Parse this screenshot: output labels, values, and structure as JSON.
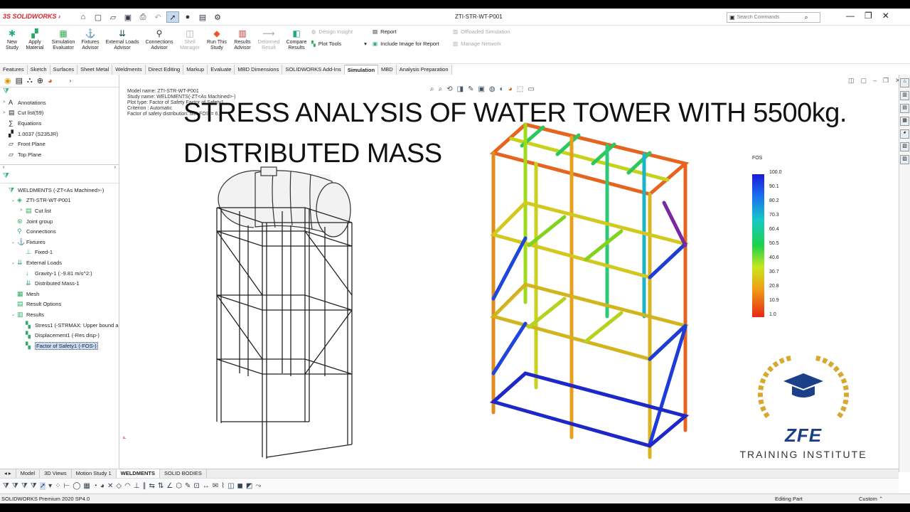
{
  "app": {
    "brand": "SOLIDWORKS",
    "document_title": "ZTI-STR-WT-P001"
  },
  "search": {
    "placeholder": "Search Commands"
  },
  "ribbon": {
    "buttons": [
      {
        "label": "New\nStudy",
        "enabled": true
      },
      {
        "label": "Apply\nMaterial",
        "enabled": true
      },
      {
        "label": "Simulation\nEvaluator",
        "enabled": true
      },
      {
        "label": "Fixtures\nAdvisor",
        "enabled": true
      },
      {
        "label": "External Loads\nAdvisor",
        "enabled": true
      },
      {
        "label": "Connections\nAdvisor",
        "enabled": true
      },
      {
        "label": "Shell\nManager",
        "enabled": false
      },
      {
        "label": "Run This\nStudy",
        "enabled": true
      },
      {
        "label": "Results\nAdvisor",
        "enabled": true
      },
      {
        "label": "Deformed\nResult",
        "enabled": false
      },
      {
        "label": "Compare\nResults",
        "enabled": true
      }
    ],
    "design_insight": "Design Insight",
    "plot_tools": "Plot Tools",
    "report": "Report",
    "include_image": "Include Image for Report",
    "offloaded": "Offloaded Simulation",
    "manage_network": "Manage Network"
  },
  "tabs": [
    "Features",
    "Sketch",
    "Surfaces",
    "Sheet Metal",
    "Weldments",
    "Direct Editing",
    "Markup",
    "Evaluate",
    "MBD Dimensions",
    "SOLIDWORKS Add-Ins",
    "Simulation",
    "MBD",
    "Analysis Preparation"
  ],
  "active_tab": "Simulation",
  "feature_tree": [
    {
      "label": "Annotations",
      "icon": "annotation-icon",
      "arrow": ">"
    },
    {
      "label": "Cut list(59)",
      "icon": "cut-list-icon",
      "arrow": ">"
    },
    {
      "label": "Equations",
      "icon": "equations-icon",
      "arrow": ""
    },
    {
      "label": "1.0037 (S235JR)",
      "icon": "material-icon",
      "arrow": ""
    },
    {
      "label": "Front Plane",
      "icon": "plane-icon",
      "arrow": ""
    },
    {
      "label": "Top Plane",
      "icon": "plane-icon",
      "arrow": ""
    }
  ],
  "sim_tree": [
    {
      "label": "WELDMENTS (-ZT<As Machined>-)",
      "icon": "study-icon",
      "indent": 0,
      "arrow": ""
    },
    {
      "label": "ZTI-STR-WT-P001",
      "icon": "part-icon",
      "indent": 1,
      "arrow": "v"
    },
    {
      "label": "Cut list",
      "icon": "cut-list-icon",
      "indent": 2,
      "arrow": ">"
    },
    {
      "label": "Joint group",
      "icon": "joint-icon",
      "indent": 1,
      "arrow": ""
    },
    {
      "label": "Connections",
      "icon": "connections-icon",
      "indent": 1,
      "arrow": ""
    },
    {
      "label": "Fixtures",
      "icon": "fixtures-icon",
      "indent": 1,
      "arrow": "v"
    },
    {
      "label": "Fixed-1",
      "icon": "fixed-icon",
      "indent": 2,
      "arrow": ""
    },
    {
      "label": "External Loads",
      "icon": "loads-icon",
      "indent": 1,
      "arrow": "v"
    },
    {
      "label": "Gravity-1 (:-9.81 m/s^2:)",
      "icon": "gravity-icon",
      "indent": 2,
      "arrow": ""
    },
    {
      "label": "Distributed Mass-1",
      "icon": "mass-icon",
      "indent": 2,
      "arrow": ""
    },
    {
      "label": "Mesh",
      "icon": "mesh-icon",
      "indent": 1,
      "arrow": ""
    },
    {
      "label": "Result Options",
      "icon": "result-options-icon",
      "indent": 1,
      "arrow": ""
    },
    {
      "label": "Results",
      "icon": "results-icon",
      "indent": 1,
      "arrow": "v"
    },
    {
      "label": "Stress1 (-STRMAX: Upper bound a",
      "icon": "plot-icon",
      "indent": 2,
      "arrow": ""
    },
    {
      "label": "Displacement1 (-Res disp-)",
      "icon": "plot-icon",
      "indent": 2,
      "arrow": ""
    },
    {
      "label": "Factor of Safety1 (-FOS-)",
      "icon": "plot-icon",
      "indent": 2,
      "arrow": "",
      "selected": true
    }
  ],
  "study_info": [
    "Model name: ZTI-STR-WT-P001",
    "Study name: WELDMENTS(-ZT<As Machined>-)",
    "Plot type: Factor of Safety Factor of Safety1",
    "Criterion : Automatic",
    "Factor of safety distribution: Min FOS = 6.8"
  ],
  "overlay": {
    "line1": "STRESS ANALYSIS OF WATER TOWER WITH 5500kg.",
    "line2": "DISTRIBUTED MASS"
  },
  "legend": {
    "title": "FOS",
    "values": [
      "100.0",
      "90.1",
      "80.2",
      "70.3",
      "60.4",
      "50.5",
      "40.6",
      "30.7",
      "20.8",
      "10.9",
      "1.0"
    ]
  },
  "logo": {
    "name": "ZFE",
    "subtitle": "TRAINING INSTITUTE"
  },
  "doc_tabs": [
    "Model",
    "3D Views",
    "Motion Study 1",
    "WELDMENTS",
    "SOLID BODIES"
  ],
  "active_doc_tab": "WELDMENTS",
  "status": {
    "version": "SOLIDWORKS Premium 2020 SP4.0",
    "mode": "Editing Part",
    "units": "Custom"
  }
}
